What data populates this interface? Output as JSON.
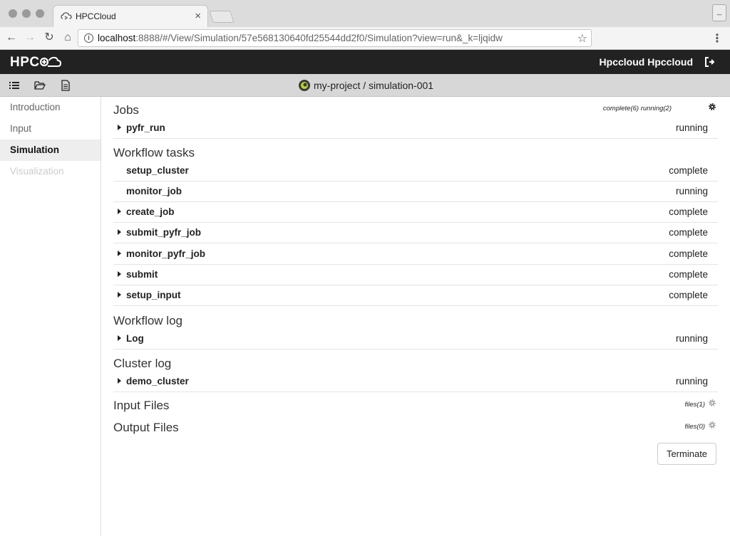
{
  "browser": {
    "tab_title": "HPCCloud",
    "tab_close": "×",
    "url_host": "localhost",
    "url_rest": ":8888/#/View/Simulation/57e568130640fd25544dd2f0/Simulation?view=run&_k=ljqidw"
  },
  "app": {
    "logo_text": "HPC",
    "user_name": "Hpccloud Hpccloud",
    "breadcrumb": "my-project / simulation-001"
  },
  "sidebar": {
    "items": [
      {
        "label": "Introduction"
      },
      {
        "label": "Input"
      },
      {
        "label": "Simulation"
      },
      {
        "label": "Visualization"
      }
    ]
  },
  "main": {
    "jobs": {
      "title": "Jobs",
      "summary": "complete(6)  running(2)",
      "rows": [
        {
          "name": "pyfr_run",
          "status": "running"
        }
      ]
    },
    "workflow_tasks": {
      "title": "Workflow tasks",
      "rows": [
        {
          "name": "setup_cluster",
          "status": "complete"
        },
        {
          "name": "monitor_job",
          "status": "running"
        },
        {
          "name": "create_job",
          "status": "complete"
        },
        {
          "name": "submit_pyfr_job",
          "status": "complete"
        },
        {
          "name": "monitor_pyfr_job",
          "status": "complete"
        },
        {
          "name": "submit",
          "status": "complete"
        },
        {
          "name": "setup_input",
          "status": "complete"
        }
      ]
    },
    "workflow_log": {
      "title": "Workflow log",
      "rows": [
        {
          "name": "Log",
          "status": "running"
        }
      ]
    },
    "cluster_log": {
      "title": "Cluster log",
      "rows": [
        {
          "name": "demo_cluster",
          "status": "running"
        }
      ]
    },
    "input_files": {
      "title": "Input Files",
      "summary": "files(1)"
    },
    "output_files": {
      "title": "Output Files",
      "summary": "files(0)"
    },
    "terminate_label": "Terminate"
  }
}
